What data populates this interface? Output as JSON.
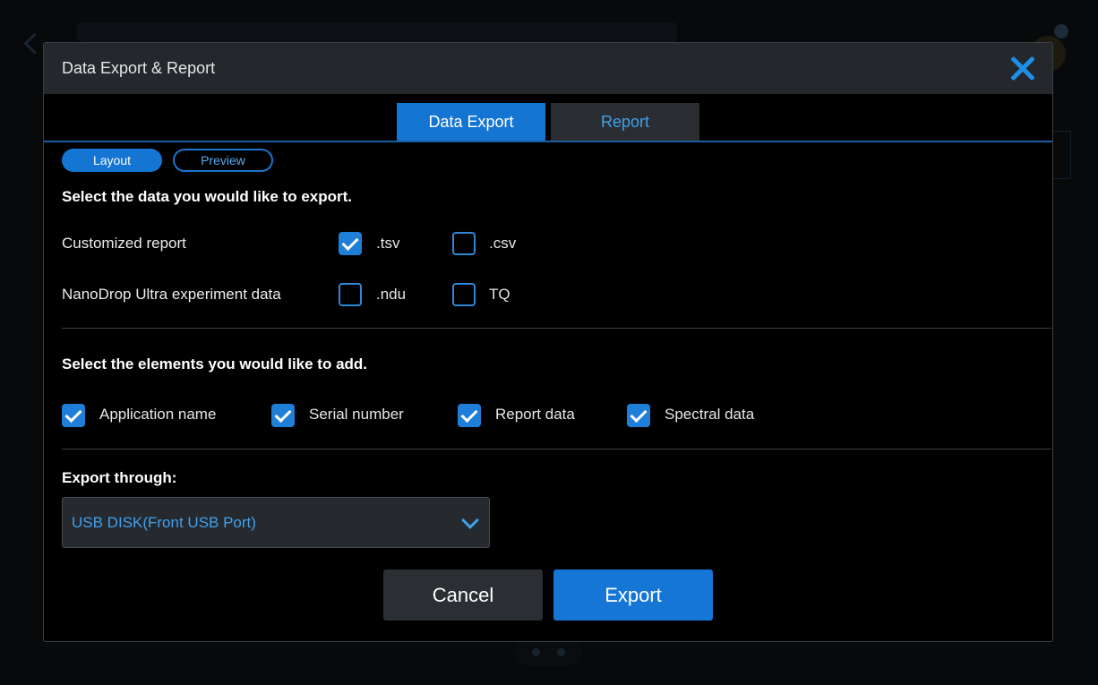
{
  "dialog": {
    "title": "Data Export & Report",
    "close_icon": "close-icon"
  },
  "tabs": [
    {
      "label": "Data Export",
      "active": true
    },
    {
      "label": "Report",
      "active": false
    }
  ],
  "view_toggle": [
    {
      "label": "Layout",
      "active": true
    },
    {
      "label": "Preview",
      "active": false
    }
  ],
  "data_section": {
    "heading": "Select the data you would like to export.",
    "rows": [
      {
        "label": "Customized report",
        "options": [
          {
            "label": ".tsv",
            "checked": true
          },
          {
            "label": ".csv",
            "checked": false
          }
        ]
      },
      {
        "label": "NanoDrop Ultra experiment data",
        "options": [
          {
            "label": ".ndu",
            "checked": false
          },
          {
            "label": "TQ",
            "checked": false
          }
        ]
      }
    ]
  },
  "elements_section": {
    "heading": "Select the elements you would like to add.",
    "options": [
      {
        "label": "Application name",
        "checked": true
      },
      {
        "label": "Serial number",
        "checked": true
      },
      {
        "label": "Report data",
        "checked": true
      },
      {
        "label": "Spectral data",
        "checked": true
      }
    ]
  },
  "export_through": {
    "heading": "Export through:",
    "selected": "USB DISK(Front USB Port)"
  },
  "buttons": {
    "cancel": "Cancel",
    "export": "Export"
  },
  "colors": {
    "accent": "#1575d2",
    "link": "#3fa1ee",
    "header_bg": "#24272c",
    "dialog_bg": "#000000"
  }
}
